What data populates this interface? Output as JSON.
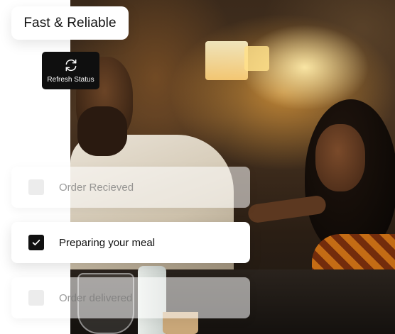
{
  "header": {
    "title": "Fast & Reliable"
  },
  "refresh": {
    "label": "Refresh Status",
    "icon": "refresh-icon"
  },
  "steps": [
    {
      "label": "Order Recieved",
      "checked": false,
      "state": "inactive"
    },
    {
      "label": "Preparing your meal",
      "checked": true,
      "state": "active"
    },
    {
      "label": "Order delivered",
      "checked": false,
      "state": "inactive"
    }
  ],
  "colors": {
    "active_check": "#111111",
    "button_bg": "#0f0f0f",
    "card_bg": "#ffffff"
  }
}
